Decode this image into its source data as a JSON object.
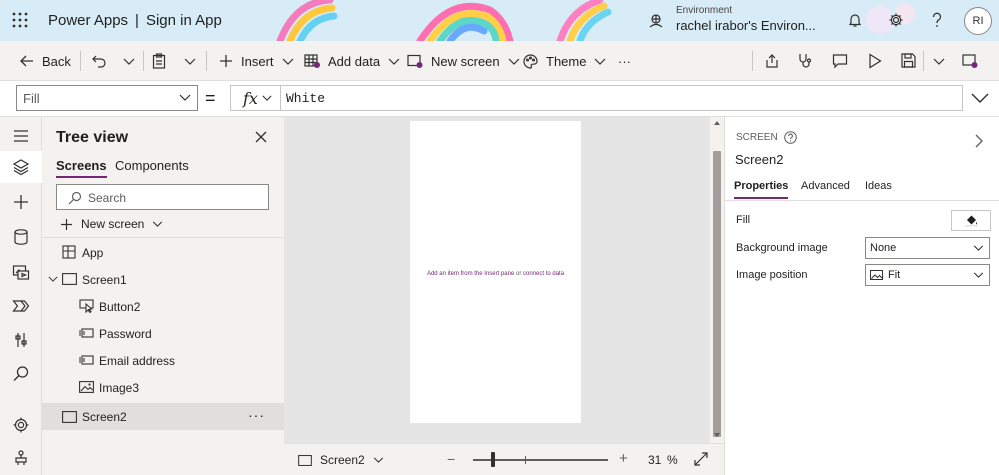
{
  "app": {
    "product": "Power Apps",
    "separator": "|",
    "app_name": "Sign in App",
    "environment_label": "Environment",
    "environment_value": "rachel irabor's Environ...",
    "user_initials": "RI"
  },
  "toolbar": {
    "back": "Back",
    "insert": "Insert",
    "add_data": "Add data",
    "new_screen": "New screen",
    "theme": "Theme",
    "more": "···"
  },
  "formula": {
    "property": "Fill",
    "equals": "=",
    "fx": "fx",
    "value": "White"
  },
  "tree": {
    "title": "Tree view",
    "tabs": [
      "Screens",
      "Components"
    ],
    "search_placeholder": "Search",
    "new_screen": "New screen",
    "nodes": {
      "app": "App",
      "screen1": "Screen1",
      "button2": "Button2",
      "password": "Password",
      "email": "Email address",
      "image3": "Image3",
      "screen2": "Screen2",
      "more": "···"
    }
  },
  "canvas": {
    "hint_prefix": "Add an item from the Insert pane",
    "hint_or": "or",
    "hint_link": "connect to data",
    "screen_selector": "Screen2",
    "zoom_minus": "−",
    "zoom_plus": "+",
    "zoom_value": "31",
    "zoom_unit": "%"
  },
  "properties": {
    "kind": "SCREEN",
    "name": "Screen2",
    "tabs": [
      "Properties",
      "Advanced",
      "Ideas"
    ],
    "fill_label": "Fill",
    "background_image_label": "Background image",
    "background_image_value": "None",
    "image_position_label": "Image position",
    "image_position_value": "Fit"
  },
  "colors": {
    "accent": "#742774",
    "topbar": "#d7ecf7",
    "chrome": "#f3f2f1"
  }
}
